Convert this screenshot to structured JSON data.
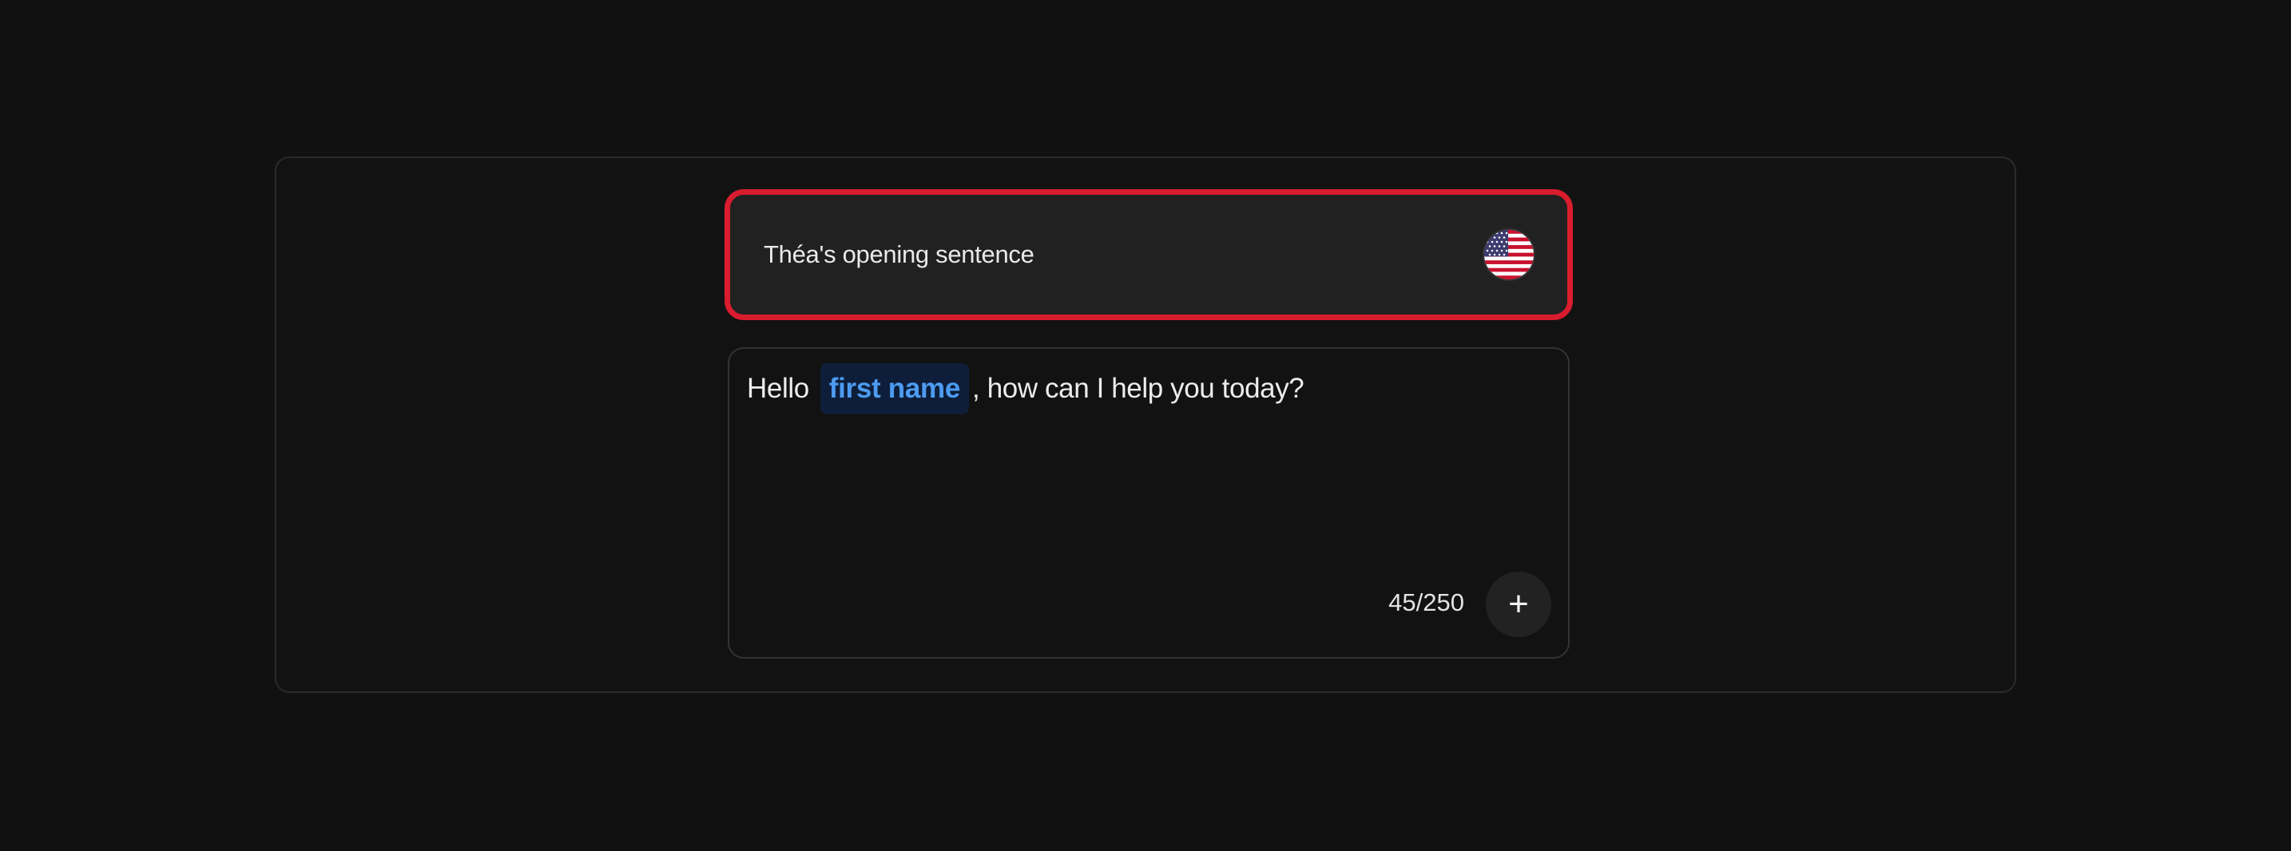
{
  "header": {
    "title": "Théa's opening sentence",
    "flag_icon": "us-flag-icon"
  },
  "editor": {
    "text_before": "Hello",
    "variable": "first name",
    "text_after": ", how can I help you today?",
    "char_count": "45/250",
    "add_label": "+"
  },
  "colors": {
    "background": "#111111",
    "highlight_border": "#d91c2e",
    "variable_text": "#4d9bf0",
    "variable_bg": "#0e1e3a"
  }
}
